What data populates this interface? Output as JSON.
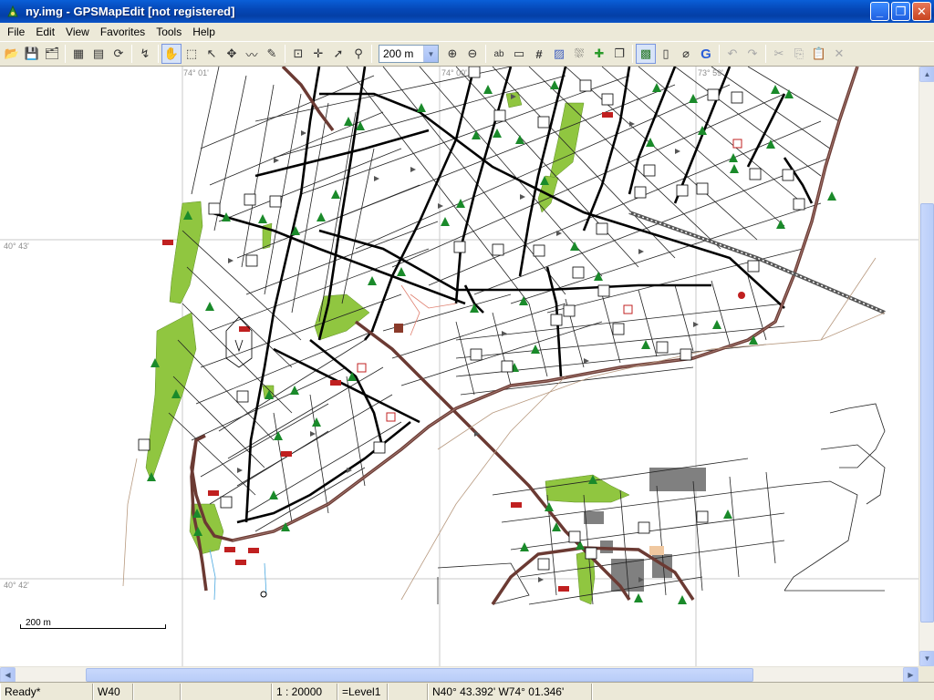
{
  "window": {
    "title": "ny.img - GPSMapEdit [not registered]",
    "buttons": {
      "minimize": "_",
      "maximize": "❐",
      "close": "✕"
    }
  },
  "menu": [
    {
      "label": "File",
      "key": "F"
    },
    {
      "label": "Edit",
      "key": "E"
    },
    {
      "label": "View",
      "key": "V"
    },
    {
      "label": "Favorites",
      "key": "a"
    },
    {
      "label": "Tools",
      "key": "T"
    },
    {
      "label": "Help",
      "key": "H"
    }
  ],
  "toolbar": {
    "scale_value": "200 m",
    "items": [
      {
        "name": "open-icon",
        "glyph": "📂"
      },
      {
        "name": "save-icon",
        "glyph": "💾"
      },
      {
        "name": "save-all-icon",
        "glyph": "🗂"
      },
      {
        "name": "properties-icon",
        "glyph": "▦"
      },
      {
        "name": "map-properties-icon",
        "glyph": "▤"
      },
      {
        "name": "transform-icon",
        "glyph": "⟳"
      },
      {
        "name": "route-icon",
        "glyph": "↯"
      },
      {
        "name": "hand-tool-icon",
        "glyph": "✋"
      },
      {
        "name": "zoom-rect-icon",
        "glyph": "⬚"
      },
      {
        "name": "select-arrow-icon",
        "glyph": "↖"
      },
      {
        "name": "drag-icon",
        "glyph": "✥"
      },
      {
        "name": "polyline-icon",
        "glyph": "〰"
      },
      {
        "name": "magic-wand-icon",
        "glyph": "✎"
      },
      {
        "name": "select-rect-icon",
        "glyph": "⊡"
      },
      {
        "name": "move-icon",
        "glyph": "✛"
      },
      {
        "name": "create-point-icon",
        "glyph": "➚"
      },
      {
        "name": "pin-icon",
        "glyph": "⚲"
      }
    ],
    "items2": [
      {
        "name": "zoom-in-icon",
        "glyph": "⊕"
      },
      {
        "name": "zoom-out-icon",
        "glyph": "⊖"
      },
      {
        "name": "labels-icon",
        "glyph": "ab"
      },
      {
        "name": "scale-icon",
        "glyph": "▭"
      },
      {
        "name": "grid-icon",
        "glyph": "#"
      },
      {
        "name": "hatch-icon",
        "glyph": "▨"
      },
      {
        "name": "nodes-icon",
        "glyph": "⛆"
      },
      {
        "name": "add-node-icon",
        "glyph": "✚"
      },
      {
        "name": "window-icon",
        "glyph": "❐"
      },
      {
        "name": "fill-icon",
        "glyph": "▩"
      },
      {
        "name": "page-icon",
        "glyph": "▯"
      },
      {
        "name": "attach-icon",
        "glyph": "⌀"
      },
      {
        "name": "google-icon",
        "glyph": "G"
      },
      {
        "name": "undo-icon",
        "glyph": "↶"
      },
      {
        "name": "redo-icon",
        "glyph": "↷"
      },
      {
        "name": "cut-icon",
        "glyph": "✂"
      },
      {
        "name": "copy-icon",
        "glyph": "⎘"
      },
      {
        "name": "paste-icon",
        "glyph": "📋"
      },
      {
        "name": "delete-icon",
        "glyph": "✕"
      }
    ]
  },
  "map": {
    "grid_labels": {
      "lon1": "74° 01'",
      "lon2": "74° 00'",
      "lon3": "73° 59'",
      "lat1": "40° 43'",
      "lat2": "40° 42'"
    },
    "scalebar_label": "200 m",
    "colors": {
      "background": "#ffffff",
      "street": "#000000",
      "major_road": "#000000",
      "highway": "#6b3a33",
      "park": "#90c640",
      "grid": "#c8c8c8",
      "building": "#808080"
    }
  },
  "status": {
    "state": "Ready*",
    "pane2": "W40",
    "pane3": "",
    "scale": "1 : 20000",
    "level": "=Level1",
    "coords": "N40°  43.392'  W74°  01.346'"
  }
}
